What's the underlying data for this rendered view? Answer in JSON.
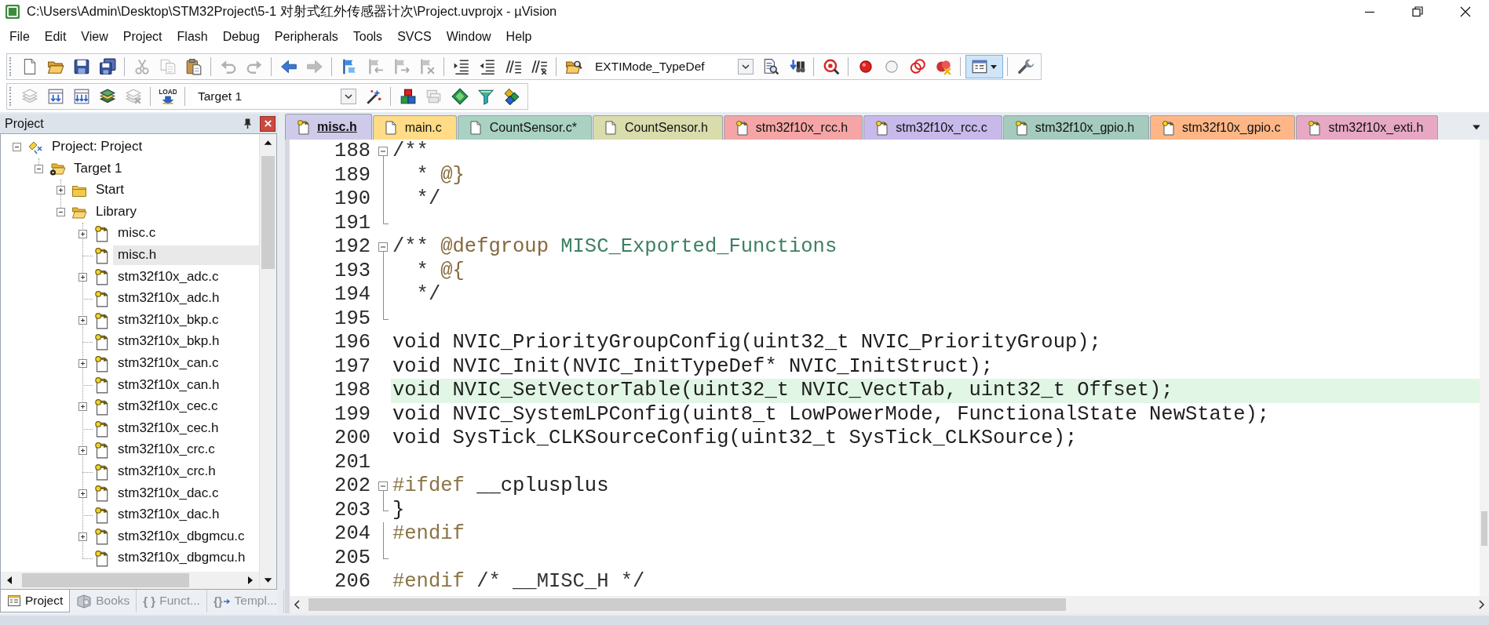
{
  "window": {
    "title": "C:\\Users\\Admin\\Desktop\\STM32Project\\5-1 对射式红外传感器计次\\Project.uvprojx - µVision"
  },
  "menu": [
    "File",
    "Edit",
    "View",
    "Project",
    "Flash",
    "Debug",
    "Peripherals",
    "Tools",
    "SVCS",
    "Window",
    "Help"
  ],
  "toolbars": [
    {
      "groups": [
        [
          {
            "kind": "new_file",
            "disabled": false,
            "pressed": false
          },
          {
            "kind": "open",
            "disabled": false,
            "pressed": false
          },
          {
            "kind": "save",
            "disabled": false,
            "pressed": false
          },
          {
            "kind": "save_all",
            "disabled": false,
            "pressed": false
          }
        ],
        [
          {
            "kind": "cut",
            "disabled": true,
            "pressed": false
          },
          {
            "kind": "copy",
            "disabled": true,
            "pressed": false
          },
          {
            "kind": "paste",
            "disabled": false,
            "pressed": false
          }
        ],
        [
          {
            "kind": "undo",
            "disabled": true,
            "pressed": false
          },
          {
            "kind": "redo",
            "disabled": true,
            "pressed": false
          }
        ],
        [
          {
            "kind": "back",
            "disabled": false,
            "pressed": false
          },
          {
            "kind": "forward",
            "disabled": true,
            "pressed": false
          }
        ],
        [
          {
            "kind": "bookmark",
            "disabled": false,
            "pressed": false
          },
          {
            "kind": "bookmark_prev",
            "disabled": true,
            "pressed": false
          },
          {
            "kind": "bookmark_next",
            "disabled": true,
            "pressed": false
          },
          {
            "kind": "bookmark_clear",
            "disabled": true,
            "pressed": false
          }
        ],
        [
          {
            "kind": "indent",
            "disabled": false,
            "pressed": false
          },
          {
            "kind": "unindent",
            "disabled": false,
            "pressed": false
          },
          {
            "kind": "comment",
            "disabled": false,
            "pressed": false
          },
          {
            "kind": "uncomment",
            "disabled": false,
            "pressed": false
          }
        ],
        [
          {
            "kind": "find_in_files",
            "disabled": false,
            "pressed": false
          },
          {
            "kind": "combo",
            "value": "EXTIMode_TypeDef",
            "disabled": false
          },
          {
            "kind": "find",
            "disabled": false,
            "pressed": false
          },
          {
            "kind": "incremental_find",
            "disabled": false,
            "pressed": false
          }
        ],
        [
          {
            "kind": "debug_search",
            "disabled": false,
            "pressed": false
          }
        ],
        [
          {
            "kind": "breakpoint",
            "disabled": false,
            "pressed": false
          },
          {
            "kind": "breakpoint_enable",
            "disabled": false,
            "pressed": false
          },
          {
            "kind": "breakpoint_disable",
            "disabled": false,
            "pressed": false
          },
          {
            "kind": "breakpoint_kill",
            "disabled": false,
            "pressed": false
          }
        ],
        [
          {
            "kind": "window",
            "disabled": false,
            "pressed": true
          }
        ],
        [
          {
            "kind": "configure",
            "disabled": false,
            "pressed": false
          }
        ]
      ]
    },
    {
      "groups": [
        [
          {
            "kind": "translate",
            "disabled": true,
            "pressed": false
          },
          {
            "kind": "build",
            "disabled": false,
            "pressed": false
          },
          {
            "kind": "rebuild",
            "disabled": false,
            "pressed": false
          },
          {
            "kind": "batch_build",
            "disabled": false,
            "pressed": false
          },
          {
            "kind": "stop_build",
            "disabled": true,
            "pressed": false
          }
        ],
        [
          {
            "kind": "download",
            "label": "LOAD",
            "disabled": false,
            "pressed": false
          }
        ],
        [
          {
            "kind": "combo",
            "value": "Target 1",
            "disabled": false
          },
          {
            "kind": "options",
            "disabled": false,
            "pressed": false
          }
        ],
        [
          {
            "kind": "components",
            "disabled": false,
            "pressed": false
          },
          {
            "kind": "packs",
            "disabled": true,
            "pressed": false
          },
          {
            "kind": "installer",
            "disabled": false,
            "pressed": false
          },
          {
            "kind": "filter",
            "disabled": false,
            "pressed": false
          },
          {
            "kind": "layers",
            "disabled": false,
            "pressed": false
          }
        ]
      ]
    }
  ],
  "project_panel": {
    "title": "Project",
    "tree": [
      {
        "label": "Project: Project",
        "kind": "project",
        "expanded": true,
        "selected": false,
        "children": [
          {
            "label": "Target 1",
            "kind": "target",
            "expanded": true,
            "selected": false,
            "children": [
              {
                "label": "Start",
                "kind": "folder",
                "expanded": false,
                "selected": false
              },
              {
                "label": "Library",
                "kind": "folder",
                "expanded": true,
                "selected": false,
                "children": [
                  {
                    "label": "misc.c",
                    "kind": "file",
                    "expanded": false,
                    "selected": false
                  },
                  {
                    "label": "misc.h",
                    "kind": "file",
                    "selected": true
                  },
                  {
                    "label": "stm32f10x_adc.c",
                    "kind": "file",
                    "expanded": false,
                    "selected": false
                  },
                  {
                    "label": "stm32f10x_adc.h",
                    "kind": "file",
                    "selected": false
                  },
                  {
                    "label": "stm32f10x_bkp.c",
                    "kind": "file",
                    "expanded": false,
                    "selected": false
                  },
                  {
                    "label": "stm32f10x_bkp.h",
                    "kind": "file",
                    "selected": false
                  },
                  {
                    "label": "stm32f10x_can.c",
                    "kind": "file",
                    "expanded": false,
                    "selected": false
                  },
                  {
                    "label": "stm32f10x_can.h",
                    "kind": "file",
                    "selected": false
                  },
                  {
                    "label": "stm32f10x_cec.c",
                    "kind": "file",
                    "expanded": false,
                    "selected": false
                  },
                  {
                    "label": "stm32f10x_cec.h",
                    "kind": "file",
                    "selected": false
                  },
                  {
                    "label": "stm32f10x_crc.c",
                    "kind": "file",
                    "expanded": false,
                    "selected": false
                  },
                  {
                    "label": "stm32f10x_crc.h",
                    "kind": "file",
                    "selected": false
                  },
                  {
                    "label": "stm32f10x_dac.c",
                    "kind": "file",
                    "expanded": false,
                    "selected": false
                  },
                  {
                    "label": "stm32f10x_dac.h",
                    "kind": "file",
                    "selected": false
                  },
                  {
                    "label": "stm32f10x_dbgmcu.c",
                    "kind": "file",
                    "expanded": false,
                    "selected": false
                  },
                  {
                    "label": "stm32f10x_dbgmcu.h",
                    "kind": "file",
                    "selected": false
                  }
                ]
              }
            ]
          }
        ]
      }
    ],
    "tabs": [
      {
        "label": "Project",
        "kind": "project",
        "selected": true
      },
      {
        "label": "Books",
        "kind": "books",
        "selected": false
      },
      {
        "label": "Funct...",
        "kind": "functions",
        "glyph": "{ }",
        "selected": false
      },
      {
        "label": "Templ...",
        "kind": "templates",
        "glyph": "{}",
        "selected": false
      }
    ]
  },
  "editor": {
    "tabs": [
      {
        "label": "misc.h",
        "read_only": true,
        "selected": true,
        "color": "#cfcae9"
      },
      {
        "label": "main.c",
        "read_only": false,
        "selected": false,
        "color": "#ffdc85"
      },
      {
        "label": "CountSensor.c*",
        "read_only": false,
        "selected": false,
        "color": "#a9d2c2"
      },
      {
        "label": "CountSensor.h",
        "read_only": false,
        "selected": false,
        "color": "#d9dcab"
      },
      {
        "label": "stm32f10x_rcc.h",
        "read_only": true,
        "selected": false,
        "color": "#f5a5a5"
      },
      {
        "label": "stm32f10x_rcc.c",
        "read_only": true,
        "selected": false,
        "color": "#c7b9ea"
      },
      {
        "label": "stm32f10x_gpio.h",
        "read_only": true,
        "selected": false,
        "color": "#a4cbbd"
      },
      {
        "label": "stm32f10x_gpio.c",
        "read_only": true,
        "selected": false,
        "color": "#ffb686"
      },
      {
        "label": "stm32f10x_exti.h",
        "read_only": true,
        "selected": false,
        "color": "#e7a8c3"
      }
    ],
    "lines": [
      {
        "number": "188",
        "kind": "fold_start",
        "highlighted": false,
        "tokens": [
          {
            "text": "/**",
            "kind": "comment"
          }
        ]
      },
      {
        "number": "189",
        "kind": "fold_line",
        "highlighted": false,
        "tokens": [
          {
            "text": "  * ",
            "kind": "comment"
          },
          {
            "text": "@}",
            "kind": "doc_tag"
          }
        ]
      },
      {
        "number": "190",
        "kind": "fold_line",
        "highlighted": false,
        "tokens": [
          {
            "text": "  */",
            "kind": "comment"
          }
        ]
      },
      {
        "number": "191",
        "kind": "fold_end",
        "highlighted": false
      },
      {
        "number": "192",
        "kind": "fold_start",
        "highlighted": false,
        "tokens": [
          {
            "text": "/** ",
            "kind": "comment"
          },
          {
            "text": "@defgroup",
            "kind": "doc_tag"
          },
          {
            "text": " MISC_Exported_Functions",
            "kind": "doc_name"
          }
        ]
      },
      {
        "number": "193",
        "kind": "fold_line",
        "highlighted": false,
        "tokens": [
          {
            "text": "  * ",
            "kind": "comment"
          },
          {
            "text": "@{",
            "kind": "doc_tag"
          }
        ]
      },
      {
        "number": "194",
        "kind": "fold_line",
        "highlighted": false,
        "tokens": [
          {
            "text": "  */",
            "kind": "comment"
          }
        ]
      },
      {
        "number": "195",
        "kind": "fold_end",
        "highlighted": false
      },
      {
        "number": "196",
        "kind": "plain",
        "highlighted": false,
        "tokens": [
          {
            "text": "void NVIC_PriorityGroupConfig(uint32_t NVIC_PriorityGroup);",
            "kind": "text"
          }
        ]
      },
      {
        "number": "197",
        "kind": "plain",
        "highlighted": false,
        "tokens": [
          {
            "text": "void NVIC_Init(NVIC_InitTypeDef* NVIC_InitStruct);",
            "kind": "text"
          }
        ]
      },
      {
        "number": "198",
        "kind": "plain",
        "highlighted": true,
        "tokens": [
          {
            "text": "void NVIC_SetVectorTable(uint32_t NVIC_VectTab, uint32_t Offset);",
            "kind": "text"
          }
        ]
      },
      {
        "number": "199",
        "kind": "plain",
        "highlighted": false,
        "tokens": [
          {
            "text": "void NVIC_SystemLPConfig(uint8_t LowPowerMode, FunctionalState NewState);",
            "kind": "text"
          }
        ]
      },
      {
        "number": "200",
        "kind": "plain",
        "highlighted": false,
        "tokens": [
          {
            "text": "void SysTick_CLKSourceConfig(uint32_t SysTick_CLKSource);",
            "kind": "text"
          }
        ]
      },
      {
        "number": "201",
        "kind": "plain",
        "highlighted": false
      },
      {
        "number": "202",
        "kind": "fold_start",
        "highlighted": false,
        "tokens": [
          {
            "text": "#ifdef",
            "kind": "preproc"
          },
          {
            "text": " __cplusplus",
            "kind": "text"
          }
        ]
      },
      {
        "number": "203",
        "kind": "fold_end",
        "highlighted": false,
        "tokens": [
          {
            "text": "}",
            "kind": "text"
          }
        ]
      },
      {
        "number": "204",
        "kind": "fold_line",
        "highlighted": false,
        "tokens": [
          {
            "text": "#endif",
            "kind": "preproc"
          }
        ]
      },
      {
        "number": "205",
        "kind": "fold_end",
        "highlighted": false
      },
      {
        "number": "206",
        "kind": "plain",
        "highlighted": false,
        "tokens": [
          {
            "text": "#endif",
            "kind": "preproc"
          },
          {
            "text": " /* __MISC_H */",
            "kind": "comment"
          }
        ]
      }
    ]
  }
}
